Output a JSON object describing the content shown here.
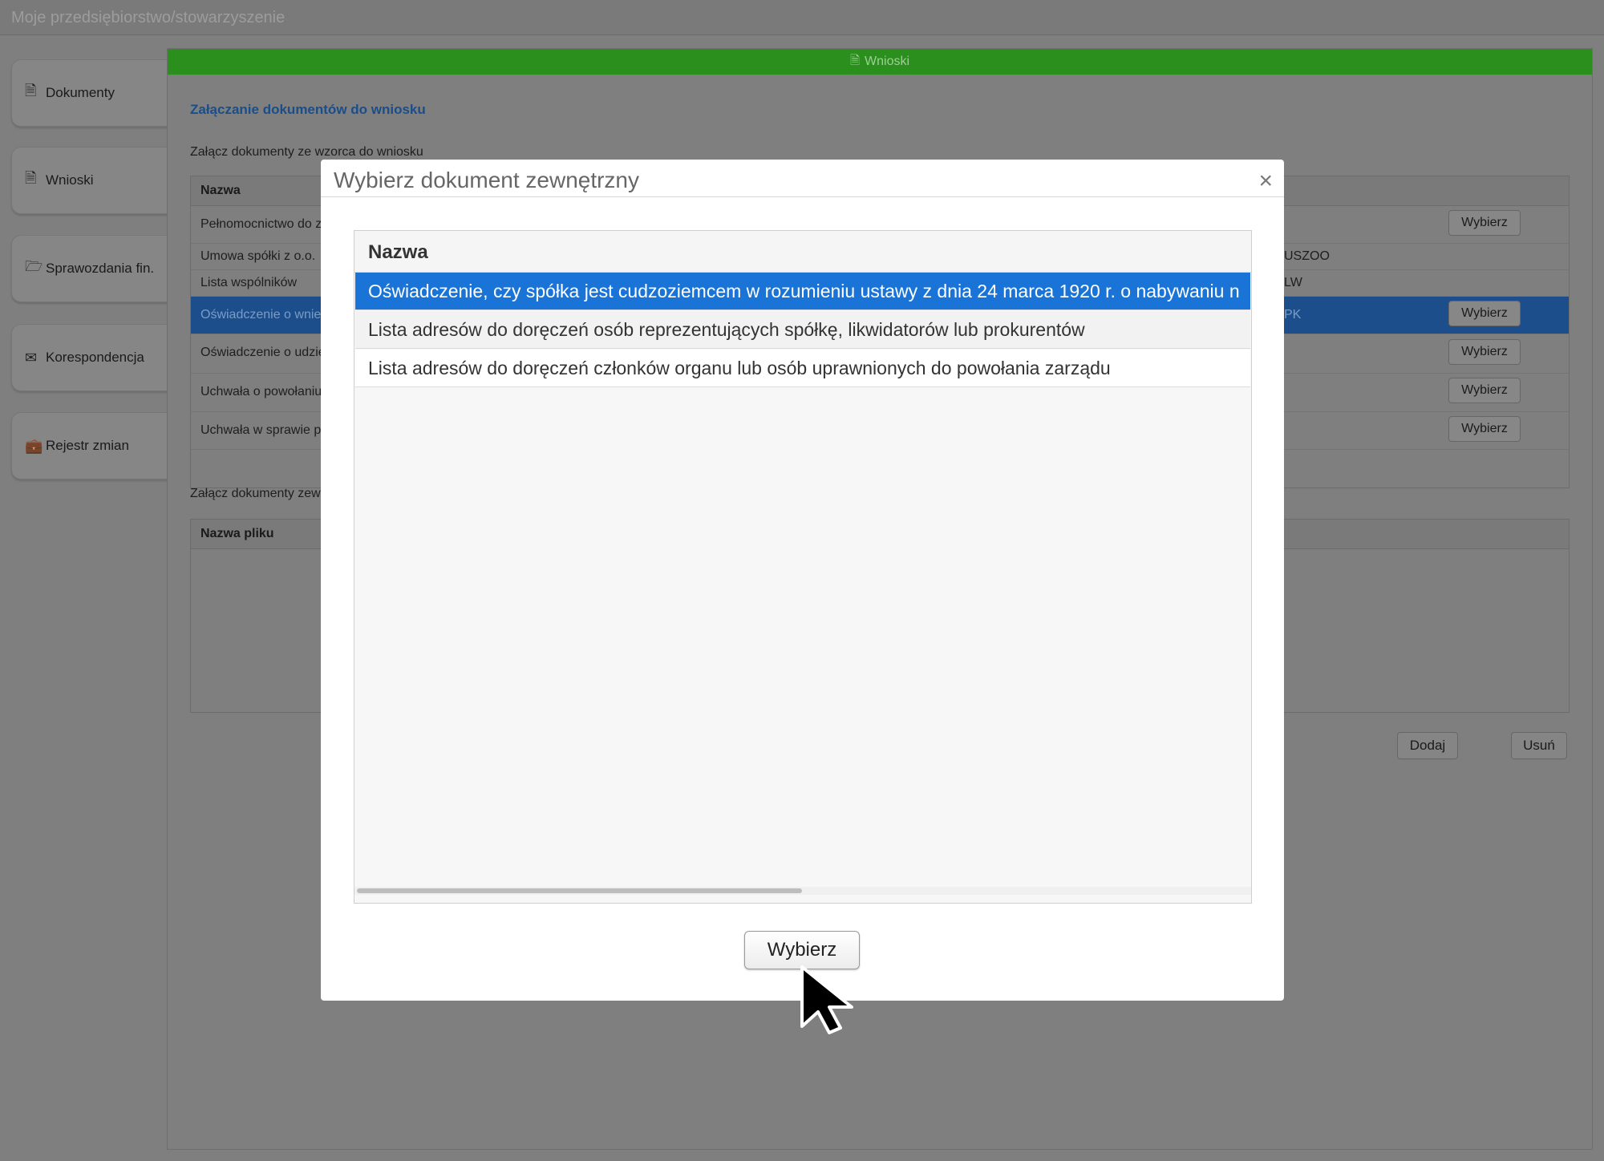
{
  "app": {
    "title": "Moje przedsiębiorstwo/stowarzyszenie"
  },
  "sidebar": {
    "items": [
      {
        "label": "Dokumenty",
        "icon": "document-icon"
      },
      {
        "label": "Wnioski",
        "icon": "document-icon"
      },
      {
        "label": "Sprawozdania fin.",
        "icon": "folder-open-icon"
      },
      {
        "label": "Korespondencja",
        "icon": "envelope-icon"
      },
      {
        "label": "Rejestr zmian",
        "icon": "briefcase-icon"
      }
    ]
  },
  "main": {
    "header": "Wnioski",
    "section_title": "Załączanie dokumentów do wniosku",
    "template_label": "Załącz dokumenty ze wzorca do wniosku",
    "template_table": {
      "col_name": "Nazwa",
      "rows": [
        {
          "name": "Pełnomocnictwo do z",
          "code": "",
          "button": "Wybierz"
        },
        {
          "name": "Umowa spółki z o.o.",
          "code": "USZOO",
          "button": ""
        },
        {
          "name": "Lista wspólników",
          "code": "LW",
          "button": ""
        },
        {
          "name": "Oświadczenie o wnie",
          "code": "PK",
          "button": "Wybierz"
        },
        {
          "name": "Oświadczenie o udzie",
          "code": "",
          "button": "Wybierz"
        },
        {
          "name": "Uchwała o powołaniu",
          "code": "",
          "button": "Wybierz"
        },
        {
          "name": "Uchwała w sprawie p",
          "code": "",
          "button": "Wybierz"
        }
      ]
    },
    "external_label": "Załącz dokumenty zew",
    "external_table": {
      "col_file": "Nazwa pliku"
    },
    "add_button": "Dodaj",
    "remove_button": "Usuń"
  },
  "modal": {
    "title": "Wybierz dokument zewnętrzny",
    "close": "×",
    "col_name": "Nazwa",
    "rows": [
      "Oświadczenie, czy spółka jest cudzoziemcem w rozumieniu ustawy z dnia 24 marca 1920 r. o nabywaniu n",
      "Lista adresów do doręczeń osób reprezentujących spółkę, likwidatorów lub prokurentów",
      "Lista adresów do doręczeń członków organu lub osób uprawnionych do powołania zarządu"
    ],
    "select_button": "Wybierz"
  },
  "colors": {
    "accent": "#1a73d6",
    "header_green": "#2a8f1c"
  }
}
